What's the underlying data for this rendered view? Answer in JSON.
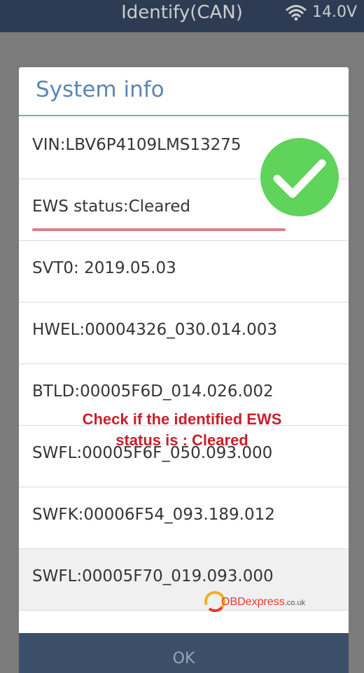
{
  "status_bar": {
    "title": "Identify(CAN)",
    "wifi_icon": "wifi-icon",
    "voltage": "14.0V"
  },
  "dialog": {
    "title": "System info",
    "rows": [
      {
        "text": "VIN:LBV6P4109LMS13275"
      },
      {
        "text": "EWS status:Cleared"
      },
      {
        "text": "SVT0: 2019.05.03"
      },
      {
        "text": "HWEL:00004326_030.014.003"
      },
      {
        "text": "BTLD:00005F6D_014.026.002"
      },
      {
        "text": "SWFL:00005F6F_050.093.000"
      },
      {
        "text": "SWFK:00006F54_093.189.012"
      },
      {
        "text": "SWFL:00005F70_019.093.000"
      }
    ],
    "ok_label": "OK"
  },
  "overlay": {
    "checkmark_icon": "checkmark-icon",
    "check_color": "#5fd35a",
    "underline_color": "#e07d86",
    "annotation_line1": "Check if the identified EWS",
    "annotation_line2": "status is : Cleared"
  },
  "watermark": {
    "brand": "OBDexpress",
    "tld": ".co.uk"
  },
  "colors": {
    "header_bg": "#2d3c52",
    "title_blue": "#5b86b4",
    "ok_bar_bg": "#3b4f69",
    "annotation_red": "#c8202a"
  }
}
